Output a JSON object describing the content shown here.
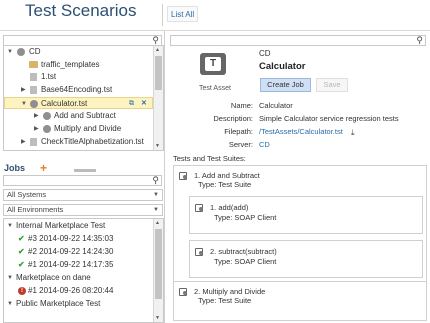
{
  "header": {
    "title": "Test Scenarios",
    "list_all": "List All"
  },
  "tree": {
    "items": [
      {
        "label": "CD",
        "expanded": true
      },
      {
        "label": "traffic_templates"
      },
      {
        "label": "1.tst"
      },
      {
        "label": "Base64Encoding.tst"
      },
      {
        "label": "Calculator.tst",
        "selected": true
      },
      {
        "label": "Add and Subtract"
      },
      {
        "label": "Multiply and Divide"
      },
      {
        "label": "CheckTitleAlphabetization.tst"
      }
    ]
  },
  "jobs": {
    "title": "Jobs",
    "add": "+",
    "systems_select": "All Systems",
    "environments_select": "All Environments",
    "items": [
      {
        "label": "Internal Marketplace Test",
        "group": true,
        "expanded": true
      },
      {
        "label": "#3 2014-09-22 14:35:03",
        "status": "success"
      },
      {
        "label": "#2 2014-09-22 14:24:30",
        "status": "success"
      },
      {
        "label": "#1 2014-09-22 14:17:35",
        "status": "success"
      },
      {
        "label": "Marketplace on dane",
        "group": true,
        "expanded": true
      },
      {
        "label": "#1 2014-09-26 08:20:44",
        "status": "error"
      },
      {
        "label": "Public Marketplace Test",
        "group": true,
        "expanded": true
      }
    ]
  },
  "asset": {
    "caption": "Test Asset",
    "path": "CD",
    "name": "Calculator",
    "create_job": "Create Job",
    "save": "Save",
    "fields": {
      "name_label": "Name:",
      "name_value": "Calculator",
      "description_label": "Description:",
      "description_value": "Simple Calculator service regression tests",
      "filepath_label": "Filepath:",
      "filepath_value": "/TestAssets/Calculator.tst",
      "server_label": "Server:",
      "server_value": "CD"
    },
    "suites_label": "Tests and Test Suites:",
    "suites": [
      {
        "title": "1. Add and Subtract",
        "type": "Type: Test Suite",
        "cases": [
          {
            "title": "1. add(add)",
            "type": "Type: SOAP Client"
          },
          {
            "title": "2. subtract(subtract)",
            "type": "Type: SOAP Client"
          }
        ]
      },
      {
        "title": "2. Multiply and Divide",
        "type": "Type: Test Suite"
      }
    ]
  },
  "colors": {
    "title": "#2d4f73",
    "link": "#2a6aa8",
    "selection": "#fdf3c0",
    "success": "#3aa03a",
    "error": "#c0392b",
    "add": "#e67e22"
  }
}
